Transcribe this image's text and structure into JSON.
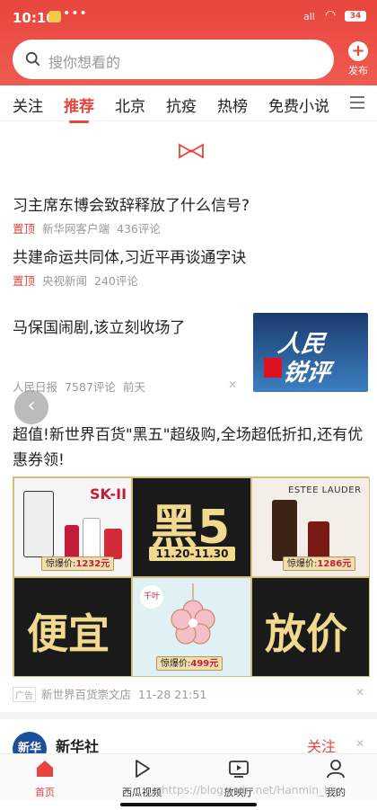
{
  "status_bar": {
    "time": "10:10",
    "dots": "•••",
    "signal": "all",
    "battery": "34"
  },
  "search": {
    "placeholder": "搜你想看的"
  },
  "publish": {
    "label": "发布"
  },
  "tabs": [
    "关注",
    "推荐",
    "北京",
    "抗疫",
    "热榜",
    "免费小说"
  ],
  "active_tab": "推荐",
  "feed": {
    "item1": {
      "title": "习主席东博会致辞释放了什么信号?",
      "tag": "置顶",
      "source": "新华网客户端",
      "comments": "436评论"
    },
    "item2": {
      "title": "共建命运共同体,习近平再谈通字诀",
      "tag": "置顶",
      "source": "央视新闻",
      "comments": "240评论"
    },
    "item3": {
      "title": "马保国闹剧,该立刻收场了",
      "source": "人民日报",
      "comments": "7587评论",
      "time": "前天",
      "thumb_line1": "人民",
      "thumb_line2": "锐评"
    },
    "ad": {
      "title": "超值!新世界百货\"黑五\"超级购,全场超低折扣,还有优惠券领!",
      "tag": "广告",
      "source": "新世界百货崇文店",
      "time": "11-28 21:51",
      "sk_brand": "SK-II",
      "el_brand": "ESTEE LAUDER",
      "black5": "黑5",
      "date_range": "11.20-11.30",
      "price1_label": "惊爆价:",
      "price1": "1232元",
      "price2_label": "惊爆价:",
      "price2": "1286元",
      "price3_label": "惊爆价:",
      "price3": "499元",
      "cheap": "便宜",
      "discount": "放价",
      "qianye": "千叶"
    },
    "item5": {
      "source_name": "新华社",
      "follow": "关注",
      "logo": "新华"
    }
  },
  "bottom_nav": [
    {
      "label": "首页",
      "icon": "home-icon"
    },
    {
      "label": "西瓜视频",
      "icon": "play-icon"
    },
    {
      "label": "放映厅",
      "icon": "tv-icon"
    },
    {
      "label": "我的",
      "icon": "user-icon"
    }
  ],
  "watermark": "https://blog.csdn.net/Hanmin_hm",
  "colors": {
    "brand": "#e8453e",
    "gold": "#f1d98e"
  }
}
